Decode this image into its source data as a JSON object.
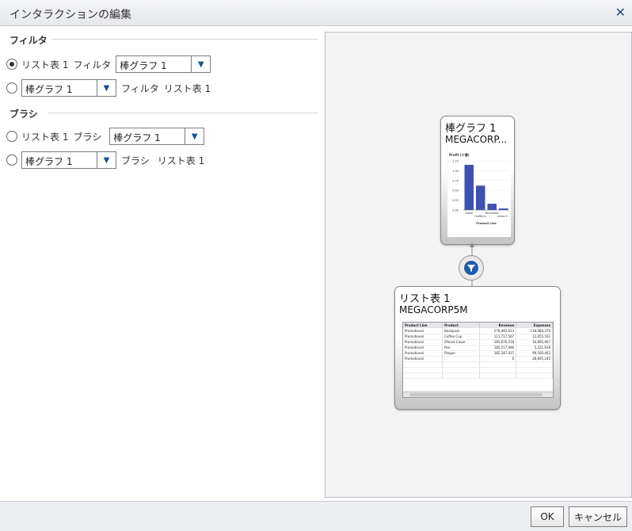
{
  "dialog": {
    "title": "インタラクションの編集"
  },
  "filter_section": {
    "heading": "フィルタ",
    "row1": {
      "source": "リスト表 1",
      "verb": "フィルタ",
      "target": "棒グラフ 1"
    },
    "row2": {
      "source": "棒グラフ 1",
      "verb": "フィルタ",
      "target": "リスト表 1"
    }
  },
  "brush_section": {
    "heading": "ブラシ",
    "row1": {
      "source": "リスト表 1",
      "verb": "ブラシ",
      "target": "棒グラフ 1"
    },
    "row2": {
      "source": "棒グラフ 1",
      "verb": "ブラシ",
      "target": "リスト表 1"
    }
  },
  "diagram": {
    "bar_card": {
      "title": "棒グラフ 1",
      "subtitle": "MEGACORP..."
    },
    "table_card": {
      "title": "リスト表 1",
      "subtitle": "MEGACORP5M"
    }
  },
  "mini_chart": {
    "ylabel": "Profit (十億)",
    "ticks": [
      "1.25",
      "1.00",
      "0.75",
      "0.50",
      "0.25",
      "0.00"
    ],
    "values": [
      1.15,
      0.62,
      0.16,
      0.04
    ],
    "categories": [
      "Game",
      "Outfitd A.",
      "Recreation",
      "Action F..."
    ],
    "xlabel": "Product Line",
    "bar_color": "#3f51b5"
  },
  "mini_table": {
    "columns": [
      "Product Line",
      "Product",
      "Revenue",
      "Expenses"
    ],
    "rows": [
      [
        "Promotional",
        "Backpack",
        "276,465,613",
        "118,084,370"
      ],
      [
        "Promotional",
        "Coffee Cup",
        "111,717,567",
        "12,055,161"
      ],
      [
        "Promotional",
        "iPhone Cover",
        "185,676,518",
        "16,895,067"
      ],
      [
        "Promotional",
        "Pen",
        "185,517,946",
        "5,221,919"
      ],
      [
        "Promotional",
        "Plaque",
        "185,587,037",
        "99,560,463"
      ],
      [
        "Promotional",
        ".",
        "0",
        "28,695,245"
      ]
    ]
  },
  "icons": {
    "close": "close-icon",
    "filter": "funnel-icon"
  },
  "buttons": {
    "ok": "OK",
    "cancel": "キャンセル"
  }
}
